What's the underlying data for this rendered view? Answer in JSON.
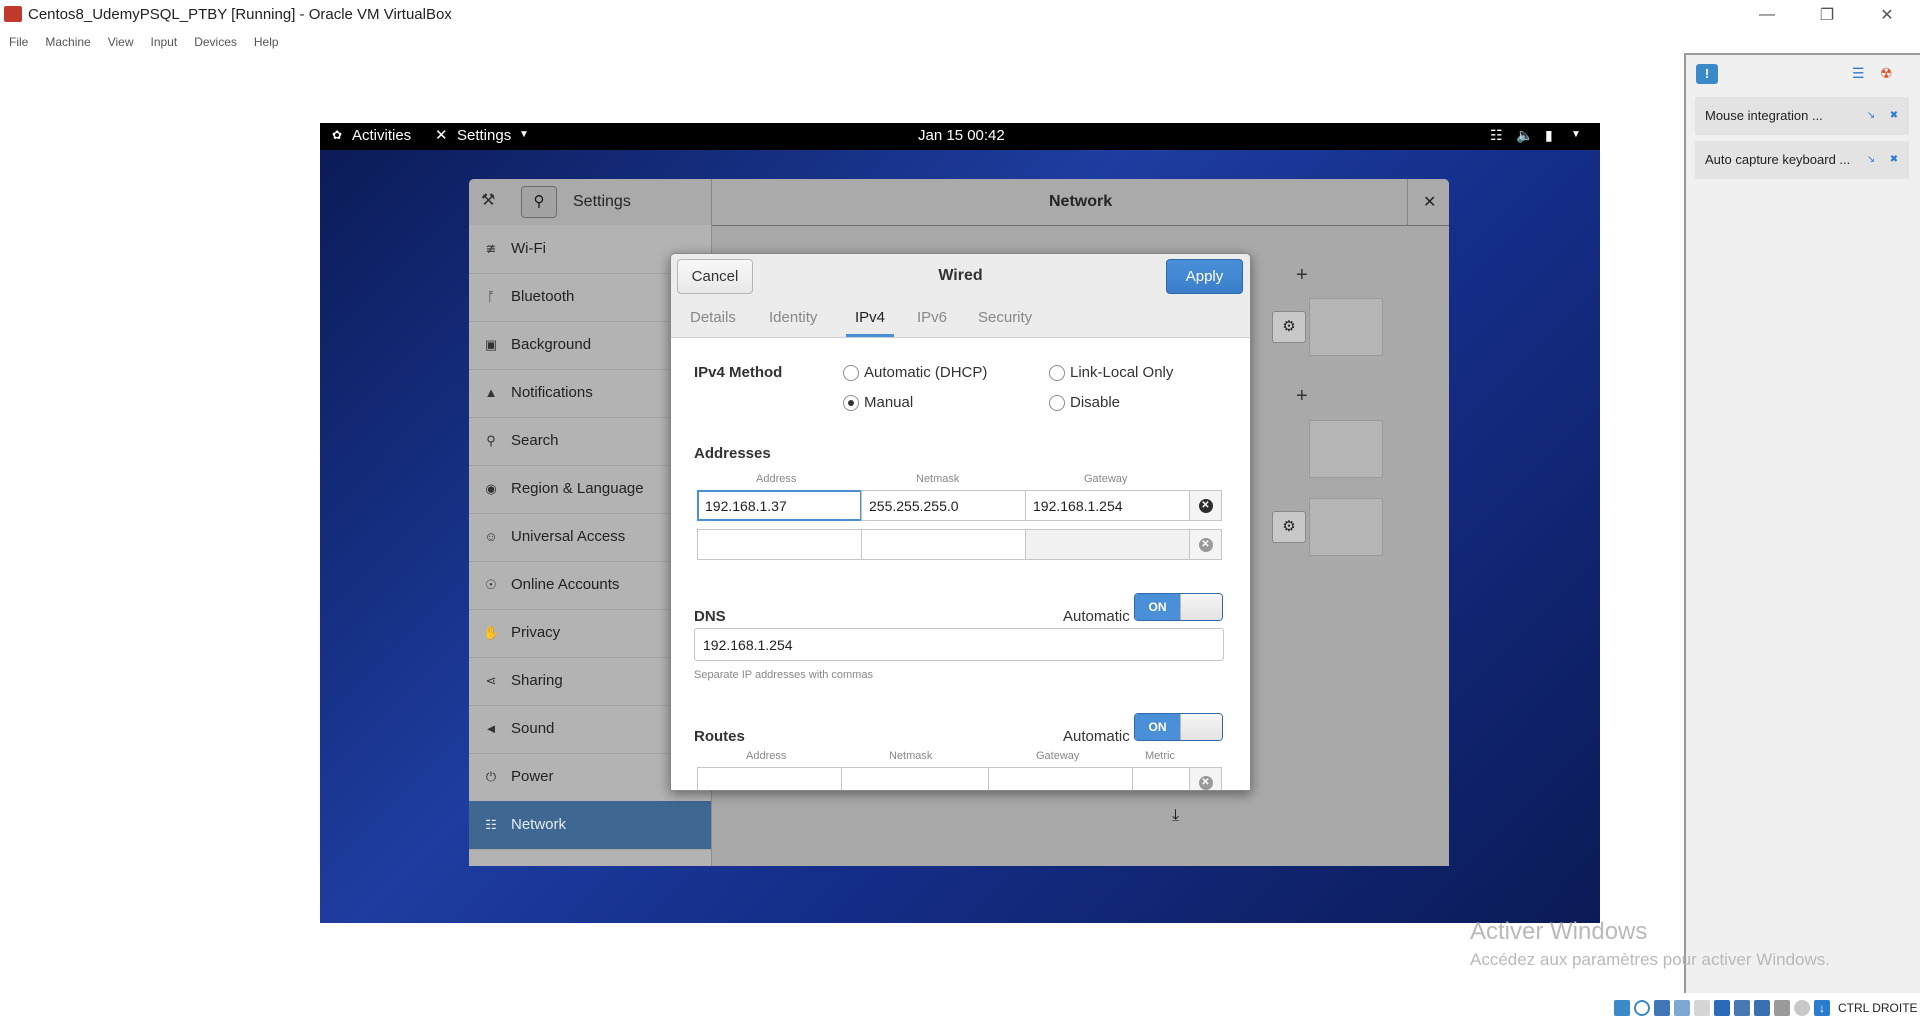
{
  "host": {
    "window_title": "Centos8_UdemyPSQL_PTBY [Running] - Oracle VM VirtualBox",
    "menu": [
      "File",
      "Machine",
      "View",
      "Input",
      "Devices",
      "Help"
    ],
    "status_host_key": "CTRL DROITE",
    "notifications": [
      {
        "label": "Mouse integration ..."
      },
      {
        "label": "Auto capture keyboard ..."
      }
    ],
    "watermark": {
      "title": "Activer Windows",
      "subtitle": "Accédez aux paramètres pour activer Windows."
    }
  },
  "guest": {
    "topbar": {
      "activities": "Activities",
      "app_menu": "Settings",
      "clock": "Jan 15  00:42"
    },
    "settings": {
      "title": "Settings",
      "panel_title": "Network",
      "sidebar": [
        {
          "label": "Wi-Fi",
          "icon": "wifi-icon"
        },
        {
          "label": "Bluetooth",
          "icon": "bluetooth-icon"
        },
        {
          "label": "Background",
          "icon": "background-icon"
        },
        {
          "label": "Notifications",
          "icon": "bell-icon"
        },
        {
          "label": "Search",
          "icon": "search-icon"
        },
        {
          "label": "Region & Language",
          "icon": "camera-icon"
        },
        {
          "label": "Universal Access",
          "icon": "accessibility-icon"
        },
        {
          "label": "Online Accounts",
          "icon": "accounts-icon"
        },
        {
          "label": "Privacy",
          "icon": "hand-icon"
        },
        {
          "label": "Sharing",
          "icon": "share-icon"
        },
        {
          "label": "Sound",
          "icon": "speaker-icon"
        },
        {
          "label": "Power",
          "icon": "power-icon"
        },
        {
          "label": "Network",
          "icon": "network-icon",
          "active": true
        }
      ]
    },
    "dialog": {
      "title": "Wired",
      "cancel_label": "Cancel",
      "apply_label": "Apply",
      "tabs": [
        "Details",
        "Identity",
        "IPv4",
        "IPv6",
        "Security"
      ],
      "active_tab": "IPv4",
      "ipv4_method": {
        "label": "IPv4 Method",
        "options": [
          "Automatic (DHCP)",
          "Link-Local Only",
          "Manual",
          "Disable"
        ],
        "selected": "Manual"
      },
      "addresses": {
        "label": "Addresses",
        "columns": [
          "Address",
          "Netmask",
          "Gateway"
        ],
        "rows": [
          {
            "address": "192.168.1.37",
            "netmask": "255.255.255.0",
            "gateway": "192.168.1.254"
          },
          {
            "address": "",
            "netmask": "",
            "gateway": ""
          }
        ]
      },
      "dns": {
        "label": "DNS",
        "automatic_label": "Automatic",
        "toggle": "ON",
        "value": "192.168.1.254",
        "hint": "Separate IP addresses with commas"
      },
      "routes": {
        "label": "Routes",
        "automatic_label": "Automatic",
        "toggle": "ON",
        "columns": [
          "Address",
          "Netmask",
          "Gateway",
          "Metric"
        ]
      }
    }
  },
  "colors": {
    "accent": "#4a90d9",
    "sidebar_active": "#3e6791"
  }
}
